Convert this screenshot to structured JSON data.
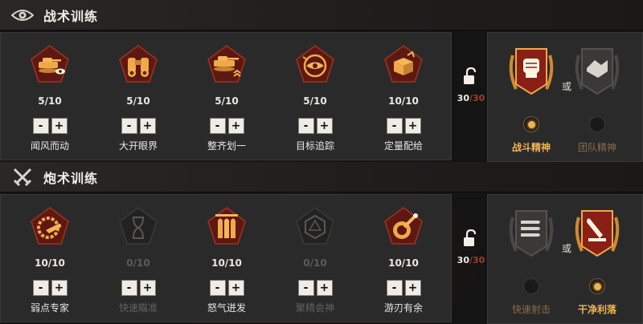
{
  "sections": {
    "tactic": {
      "title": "战术训练",
      "skills": [
        {
          "name": "闻风而动",
          "progress": "5/10",
          "locked": false,
          "icon": "tank-eye-icon"
        },
        {
          "name": "大开眼界",
          "progress": "5/10",
          "locked": false,
          "icon": "binoculars-icon"
        },
        {
          "name": "整齐划一",
          "progress": "5/10",
          "locked": false,
          "icon": "tank-rank-icon"
        },
        {
          "name": "目标追踪",
          "progress": "5/10",
          "locked": false,
          "icon": "target-eye-icon"
        },
        {
          "name": "定量配给",
          "progress": "10/10",
          "locked": false,
          "icon": "ration-box-icon"
        }
      ],
      "points": {
        "current": "30",
        "max": "/30"
      },
      "choice": {
        "or": "或",
        "options": [
          {
            "label": "战斗精神",
            "selected": true,
            "icon": "fist-badge-icon"
          },
          {
            "label": "团队精神",
            "selected": false,
            "icon": "handshake-badge-icon"
          }
        ]
      }
    },
    "gunnery": {
      "title": "炮术训练",
      "skills": [
        {
          "name": "弱点专家",
          "progress": "10/10",
          "locked": false,
          "icon": "shell-gear-icon"
        },
        {
          "name": "快速瞄准",
          "progress": "0/10",
          "locked": true,
          "icon": "hourglass-icon"
        },
        {
          "name": "怒气迸发",
          "progress": "10/10",
          "locked": false,
          "icon": "shells-icon"
        },
        {
          "name": "聚精会神",
          "progress": "0/10",
          "locked": true,
          "icon": "d20-dice-icon"
        },
        {
          "name": "游刃有余",
          "progress": "10/10",
          "locked": false,
          "icon": "gun-target-icon"
        }
      ],
      "points": {
        "current": "30",
        "max": "/30"
      },
      "choice": {
        "or": "或",
        "options": [
          {
            "label": "快速射击",
            "selected": false,
            "icon": "ammo-rack-badge-icon"
          },
          {
            "label": "干净利落",
            "selected": true,
            "icon": "shell-hit-badge-icon"
          }
        ]
      }
    }
  },
  "stepper": {
    "minus": "-",
    "plus": "+"
  },
  "colors": {
    "accent": "#f1b650",
    "emblem_red": "#8a1f16",
    "locked_text": "#64625e"
  }
}
